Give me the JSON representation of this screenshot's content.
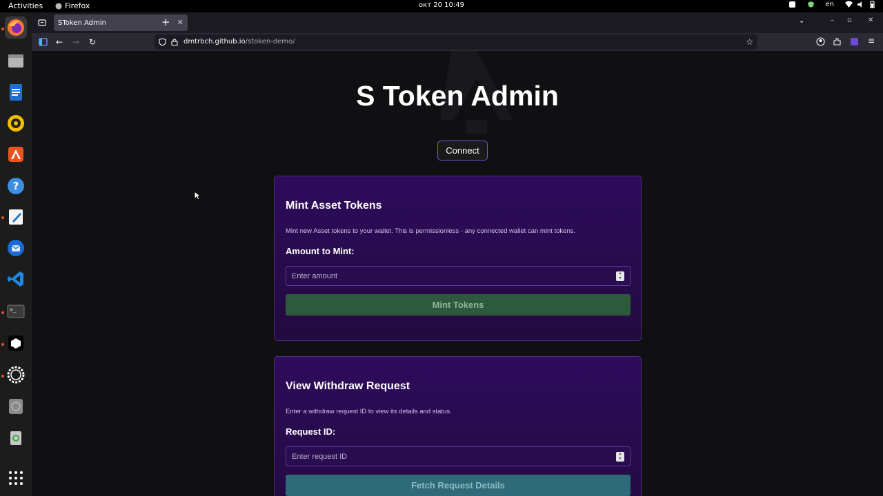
{
  "topbar": {
    "activities": "Activities",
    "app_name": "Firefox",
    "clock": "окт 20  10:49",
    "lang": "en"
  },
  "dock": {
    "items": [
      "firefox-icon",
      "files-icon",
      "writer-icon",
      "rhythmbox-icon",
      "app-center-icon",
      "help-icon",
      "text-editor-icon",
      "thunderbird-icon",
      "vscode-icon",
      "terminal-icon",
      "package-icon",
      "settings-icon",
      "disc-icon",
      "trash-icon",
      "app-grid-icon"
    ]
  },
  "browser": {
    "tab_title": "SToken Admin",
    "url_host": "dmtrbch.github.io",
    "url_path": "/stoken-demo/"
  },
  "page": {
    "title": "S Token Admin",
    "connect_label": "Connect",
    "mint": {
      "heading": "Mint Asset Tokens",
      "description": "Mint new Asset tokens to your wallet. This is permissionless - any connected wallet can mint tokens.",
      "amount_label": "Amount to Mint:",
      "amount_placeholder": "Enter amount",
      "button_label": "Mint Tokens"
    },
    "withdraw": {
      "heading": "View Withdraw Request",
      "description": "Enter a withdraw request ID to view its details and status.",
      "request_label": "Request ID:",
      "request_placeholder": "Enter request ID",
      "button_label": "Fetch Request Details"
    }
  },
  "colors": {
    "mint_button": "#2e5a3c",
    "fetch_button": "#2e6a78",
    "card_border": "#4d2e80",
    "connect_border": "#6f5ad1"
  }
}
